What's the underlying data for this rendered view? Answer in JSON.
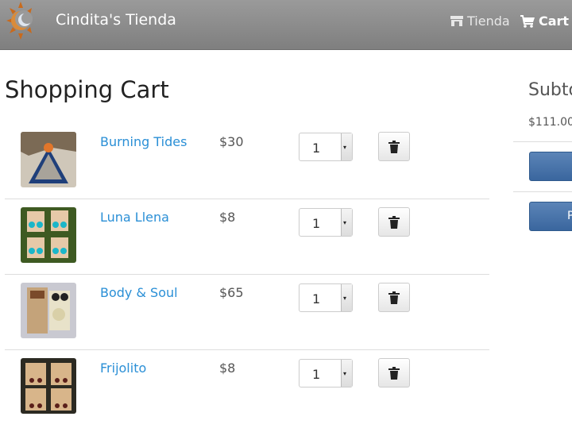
{
  "header": {
    "brand": "Cindita's Tienda",
    "nav_tienda": "Tienda",
    "nav_cart": "Cart"
  },
  "page_title": "Shopping Cart",
  "cart": {
    "items": [
      {
        "name": "Burning Tides",
        "price": "$30",
        "quantity": "1"
      },
      {
        "name": "Luna Llena",
        "price": "$8",
        "quantity": "1"
      },
      {
        "name": "Body & Soul",
        "price": "$65",
        "quantity": "1"
      },
      {
        "name": "Frijolito",
        "price": "$8",
        "quantity": "1"
      }
    ]
  },
  "summary": {
    "title": "Subtotal",
    "value": "$111.00",
    "button1_label": "",
    "button2_label": "P"
  },
  "colors": {
    "link": "#2a8fd6",
    "navbar": "#8c8c8c",
    "primary_button": "#4672a8"
  }
}
